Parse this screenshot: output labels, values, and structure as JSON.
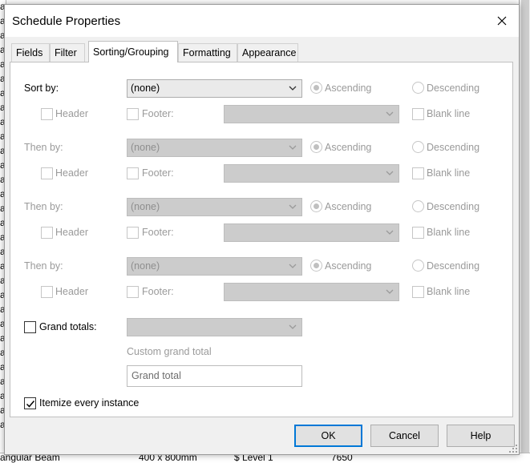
{
  "background": {
    "left_cells": [
      "a",
      "a",
      "a",
      "a",
      "a",
      "a",
      "a",
      "a",
      "a",
      "a",
      "a",
      "a",
      "a",
      "a",
      "a",
      "a",
      "a",
      "a",
      "a",
      "a",
      "a",
      "a",
      "a",
      "a",
      "a",
      "a",
      "a",
      "a",
      "a",
      "a"
    ],
    "bottom_row": [
      "angular Beam",
      "400 x 800mm",
      "$  Level 1",
      "7650"
    ]
  },
  "dialog": {
    "title": "Schedule Properties",
    "tabs": [
      {
        "label": "Fields"
      },
      {
        "label": "Filter"
      },
      {
        "label": "Sorting/Grouping"
      },
      {
        "label": "Formatting"
      },
      {
        "label": "Appearance"
      }
    ],
    "sort_rows": [
      {
        "label": "Sort by:",
        "value": "(none)",
        "header": "Header",
        "footer": "Footer:",
        "asc": "Ascending",
        "desc": "Descending",
        "blank": "Blank line"
      },
      {
        "label": "Then by:",
        "value": "(none)",
        "header": "Header",
        "footer": "Footer:",
        "asc": "Ascending",
        "desc": "Descending",
        "blank": "Blank line"
      },
      {
        "label": "Then by:",
        "value": "(none)",
        "header": "Header",
        "footer": "Footer:",
        "asc": "Ascending",
        "desc": "Descending",
        "blank": "Blank line"
      },
      {
        "label": "Then by:",
        "value": "(none)",
        "header": "Header",
        "footer": "Footer:",
        "asc": "Ascending",
        "desc": "Descending",
        "blank": "Blank line"
      }
    ],
    "grand_totals": {
      "label": "Grand totals:",
      "checked": false,
      "value": ""
    },
    "custom_grand_total": {
      "label": "Custom grand total",
      "value": "Grand total"
    },
    "itemize": {
      "label": "Itemize every instance",
      "checked": true
    },
    "buttons": {
      "ok": "OK",
      "cancel": "Cancel",
      "help": "Help"
    },
    "colors": {
      "accent": "#0078d7",
      "panel": "#ffffff",
      "dialog_bg": "#f0f0f0"
    }
  }
}
